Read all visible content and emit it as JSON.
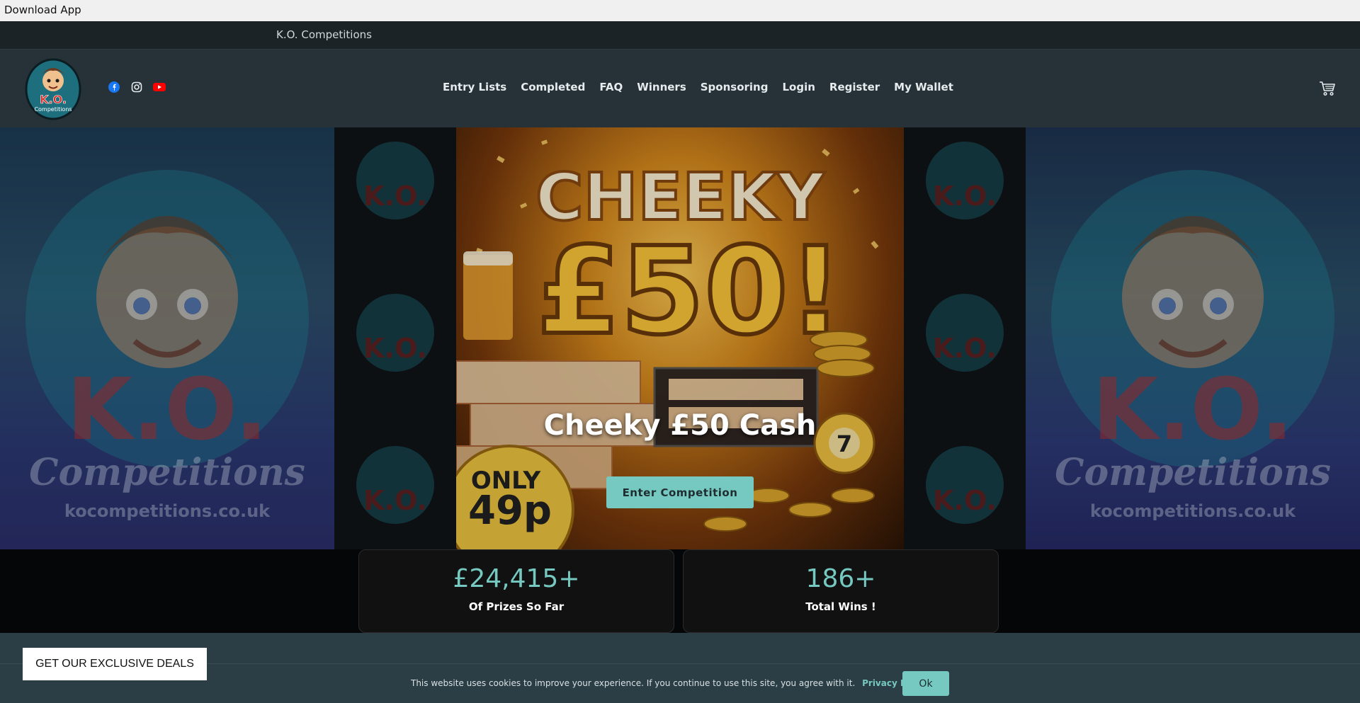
{
  "download_bar": {
    "label": "Download App"
  },
  "topstrip": {
    "site_name": "K.O. Competitions"
  },
  "header": {
    "nav": [
      {
        "label": "Entry Lists"
      },
      {
        "label": "Completed"
      },
      {
        "label": "FAQ"
      },
      {
        "label": "Winners"
      },
      {
        "label": "Sponsoring"
      },
      {
        "label": "Login"
      },
      {
        "label": "Register"
      },
      {
        "label": "My Wallet"
      }
    ],
    "socials": [
      "facebook-icon",
      "instagram-icon",
      "youtube-icon"
    ],
    "cart_icon": "cart-icon"
  },
  "hero": {
    "poster_headline": "CHEEKY",
    "poster_amount": "£50!",
    "poster_badge_top": "ONLY",
    "poster_badge_price": "49p",
    "poster_ball": "7",
    "title": "Cheeky £50 Cash",
    "cta_label": "Enter Competition",
    "logo_text": "K.O.",
    "logo_sub": "Competitions",
    "logo_url": "kocompetitions.co.uk"
  },
  "stats": [
    {
      "value": "£24,415+",
      "label": "Of Prizes So Far"
    },
    {
      "value": "186+",
      "label": "Total Wins !"
    }
  ],
  "cookie": {
    "message": "This website uses cookies to improve your experience. If you continue to use this site, you agree with it.",
    "policy_link": "Privacy Policy",
    "ok_label": "Ok"
  },
  "deals": {
    "label": "GET OUR EXCLUSIVE DEALS"
  },
  "colors": {
    "accent": "#75c9c0",
    "header_bg": "#263238",
    "topstrip_bg": "#1b2327",
    "facebook": "#1877f2",
    "youtube": "#ff0000"
  }
}
